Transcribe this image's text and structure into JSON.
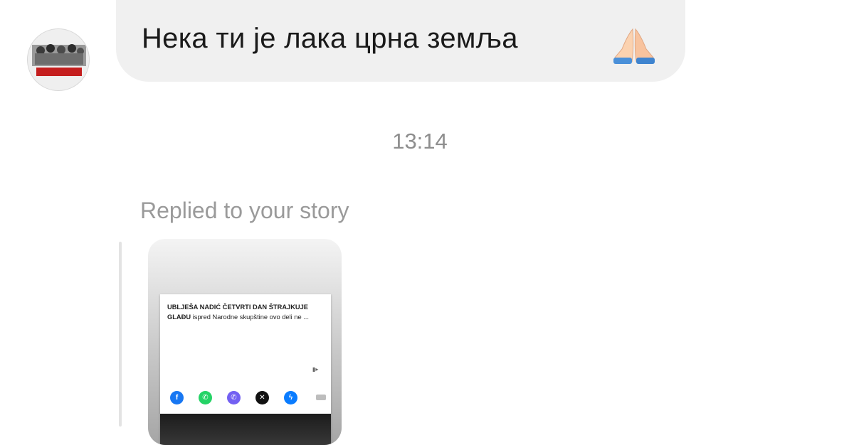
{
  "thread": {
    "avatar": {
      "icon": "group-photo-avatar"
    },
    "incoming_message": {
      "text": "Нека ти је лака црна земља",
      "emoji": "folded-hands-icon"
    },
    "timestamp": "13:14",
    "story_reply": {
      "label": "Replied to your story",
      "preview": {
        "headline_bold": "UBLJEŠA NADIĆ ČETVRTI DAN ŠTRAJKUJE GLAĐU",
        "headline_rest": " ispred Narodne skupštine ovo deli ne ...",
        "share_icons": [
          "facebook-icon",
          "whatsapp-icon",
          "viber-icon",
          "x-icon",
          "messenger-icon",
          "more-icon"
        ],
        "colors": {
          "facebook": "#1877f2",
          "whatsapp": "#25d366",
          "viber": "#7360f2",
          "x": "#111111",
          "messenger": "#0a7cff"
        }
      }
    }
  }
}
